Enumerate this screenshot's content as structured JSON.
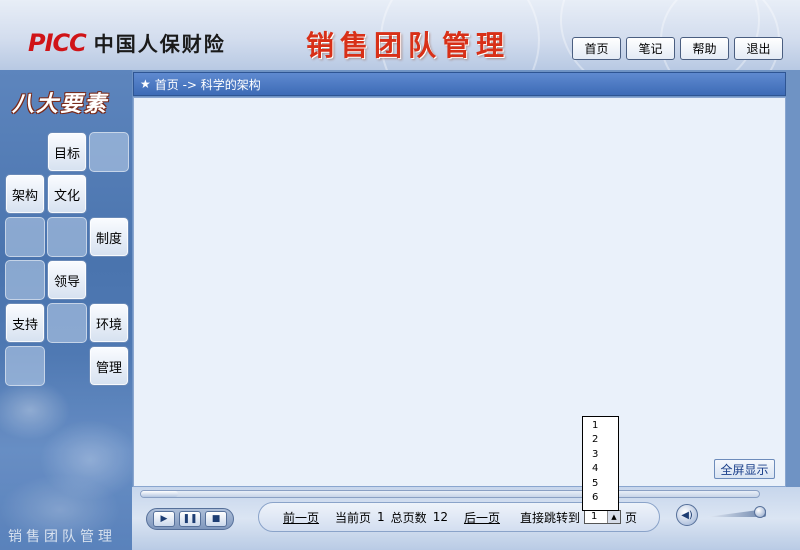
{
  "header": {
    "brand_logo": "PICC",
    "brand_name": "中国人保财险",
    "app_title": "销售团队管理",
    "nav": [
      {
        "label": "首页"
      },
      {
        "label": "笔记"
      },
      {
        "label": "帮助"
      },
      {
        "label": "退出"
      }
    ]
  },
  "sidebar": {
    "heading": "八大要素",
    "tiles": {
      "goal": "目标",
      "structure": "架构",
      "culture": "文化",
      "system": "制度",
      "leadership": "领导",
      "support": "支持",
      "environment": "环境",
      "management": "管理"
    },
    "footer": "销售团队管理"
  },
  "breadcrumb": {
    "star": "★",
    "path": "首页 -> 科学的架构"
  },
  "content": {
    "fullscreen_label": "全屏显示"
  },
  "player": {
    "progress": 0.06,
    "play_symbol": "▶",
    "pause_symbol": "❚❚",
    "stop_symbol": "■",
    "volume_symbol": "◀)",
    "volume_level": 0.9
  },
  "pager": {
    "prev_label": "前一页",
    "current_label": "当前页",
    "current_value": "1",
    "total_label": "总页数",
    "total_value": "12",
    "next_label": "后一页",
    "jump_label": "直接跳转到",
    "jump_value": "1",
    "page_suffix": "页",
    "dropdown_options": [
      "1",
      "2",
      "3",
      "4",
      "5",
      "6"
    ]
  }
}
